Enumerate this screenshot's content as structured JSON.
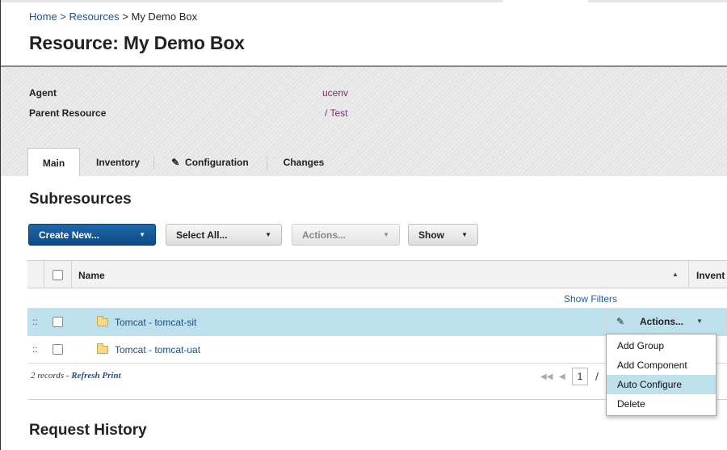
{
  "breadcrumb": {
    "home": "Home",
    "sep1": " > ",
    "resources": "Resources",
    "sep2": " > ",
    "current": "My Demo Box"
  },
  "page_title": "Resource: My Demo Box",
  "properties": [
    {
      "label": "Agent",
      "value": "ucenv"
    },
    {
      "label": "Parent Resource",
      "value": "/ Test"
    }
  ],
  "tabs": [
    {
      "label": "Main",
      "active": true
    },
    {
      "label": "Inventory"
    },
    {
      "label": "Configuration",
      "icon": "pencil-icon"
    },
    {
      "label": "Changes"
    }
  ],
  "subresources": {
    "heading": "Subresources",
    "toolbar": {
      "create_new": "Create New...",
      "select_all": "Select All...",
      "actions": "Actions...",
      "show": "Show"
    },
    "columns": {
      "name": "Name",
      "inventory": "Invent"
    },
    "show_filters": "Show Filters",
    "rows": [
      {
        "name": "Tomcat - tomcat-sit",
        "selected": true,
        "actions": "Actions..."
      },
      {
        "name": "Tomcat - tomcat-uat"
      }
    ],
    "footer": {
      "records": "2 records",
      "sep": "-",
      "refresh": "Refresh",
      "print": "Print"
    },
    "pager": {
      "page": "1",
      "slash": "/"
    },
    "actions_menu": [
      {
        "label": "Add Group"
      },
      {
        "label": "Add Component"
      },
      {
        "label": "Auto Configure",
        "highlighted": true
      },
      {
        "label": "Delete"
      }
    ]
  },
  "request_history": {
    "heading": "Request History"
  },
  "colors": {
    "selected_row": "#bde0ec",
    "primary_button": "#0b4a86",
    "link": "#1f4e8c"
  }
}
